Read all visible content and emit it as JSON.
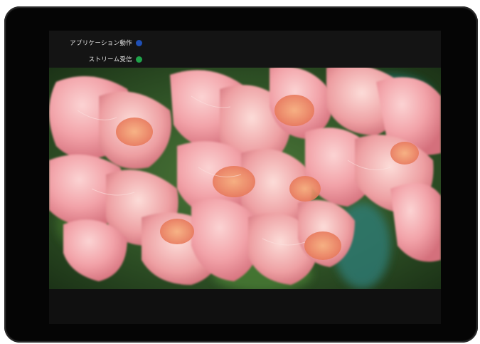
{
  "status": {
    "app_label": "アプリケーション動作",
    "app_color": "#1f4fb5",
    "stream_label": "ストリーム受信",
    "stream_color": "#1fa24a"
  },
  "video": {
    "content": "flower-image",
    "colors": {
      "petal": "#f2a0a6",
      "petal_light": "#f8c6c8",
      "petal_dark": "#d9717c",
      "center": "#f08a5d",
      "leaf": "#3f6b2e",
      "background": "#2d4a24"
    }
  }
}
